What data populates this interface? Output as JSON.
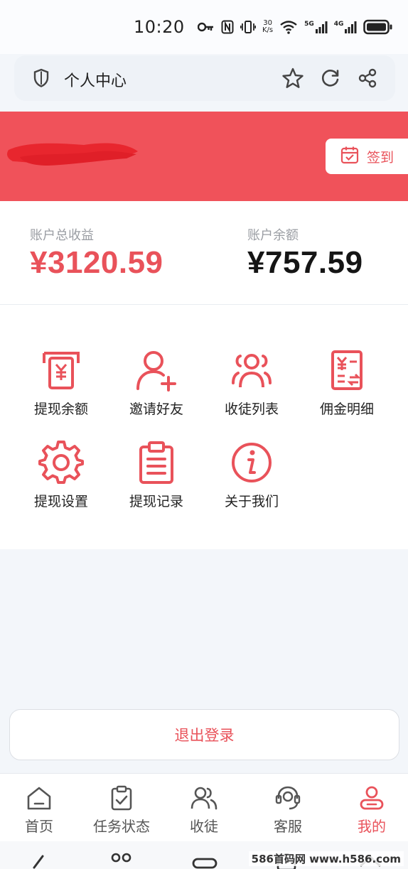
{
  "status_bar": {
    "time": "10:20",
    "speed_top": "30",
    "speed_bottom": "K/s",
    "net1": "5G",
    "net2": "4G",
    "icons": [
      "key-icon",
      "nfc-icon",
      "vibrate-icon",
      "wifi-icon",
      "signal-icon",
      "signal-icon",
      "battery-icon"
    ]
  },
  "browser": {
    "title": "个人中心",
    "icons": [
      "shield-icon",
      "star-icon",
      "refresh-icon",
      "share-icon"
    ]
  },
  "header": {
    "checkin_label": "签到"
  },
  "balance": {
    "total_label": "账户总收益",
    "total_value": "¥3120.59",
    "balance_label": "账户余额",
    "balance_value": "¥757.59"
  },
  "menu": {
    "items": [
      {
        "label": "提现余额",
        "icon": "atm-withdraw-icon"
      },
      {
        "label": "邀请好友",
        "icon": "add-user-icon"
      },
      {
        "label": "收徒列表",
        "icon": "group-icon"
      },
      {
        "label": "佣金明细",
        "icon": "commission-icon"
      },
      {
        "label": "提现设置",
        "icon": "gear-icon"
      },
      {
        "label": "提现记录",
        "icon": "clipboard-icon"
      },
      {
        "label": "关于我们",
        "icon": "info-icon"
      }
    ]
  },
  "logout_label": "退出登录",
  "tabs": [
    {
      "label": "首页",
      "icon": "home-icon"
    },
    {
      "label": "任务状态",
      "icon": "task-icon"
    },
    {
      "label": "收徒",
      "icon": "users-icon"
    },
    {
      "label": "客服",
      "icon": "headset-icon"
    },
    {
      "label": "我的",
      "icon": "profile-icon",
      "active": true
    }
  ],
  "colors": {
    "accent": "#e9525a",
    "header_bg": "#f0525a",
    "page_bg": "#f3f6fa"
  },
  "watermark": "586首码网 www.h586.com"
}
